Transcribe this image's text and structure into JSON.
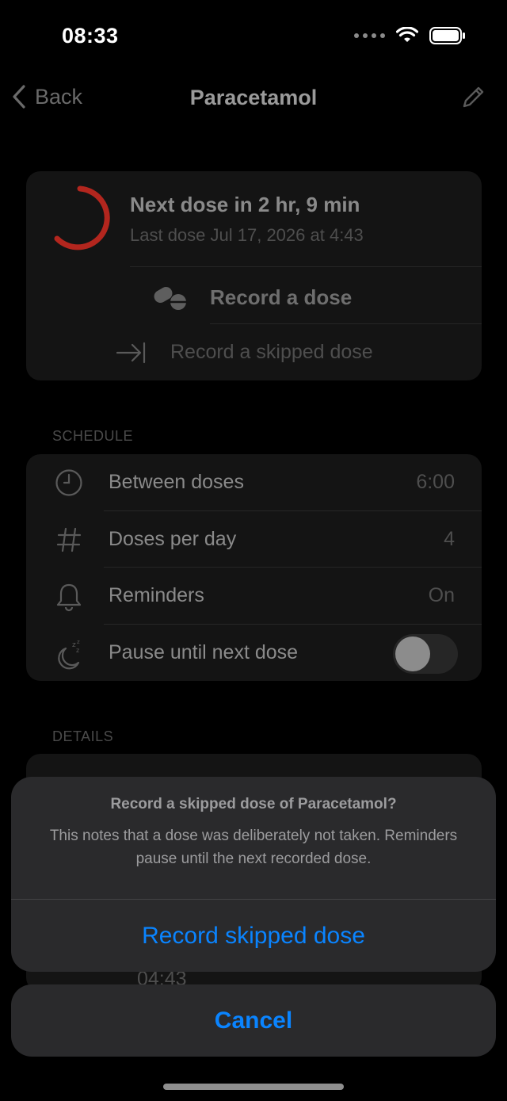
{
  "status_bar": {
    "time": "08:33"
  },
  "nav": {
    "back_label": "Back",
    "title": "Paracetamol"
  },
  "dose_card": {
    "next_dose": "Next dose in 2 hr, 9 min",
    "last_dose": "Last dose Jul 17, 2026 at 4:43",
    "record_dose_label": "Record a dose",
    "record_skipped_label": "Record a skipped dose",
    "ring_color": "#b3261e"
  },
  "schedule": {
    "header": "SCHEDULE",
    "rows": [
      {
        "icon": "clock-icon",
        "label": "Between doses",
        "value": "6:00"
      },
      {
        "icon": "hash-icon",
        "label": "Doses per day",
        "value": "4"
      },
      {
        "icon": "bell-icon",
        "label": "Reminders",
        "value": "On"
      },
      {
        "icon": "moon-zzz-icon",
        "label": "Pause until next dose",
        "toggle": false
      }
    ]
  },
  "details": {
    "header": "DETAILS",
    "peek_value": "04:43"
  },
  "action_sheet": {
    "title": "Record a skipped dose of Paracetamol?",
    "message": "This notes that a dose was deliberately not taken. Reminders pause until the next recorded dose.",
    "action_label": "Record skipped dose",
    "cancel_label": "Cancel",
    "accent_color": "#0a84ff"
  }
}
